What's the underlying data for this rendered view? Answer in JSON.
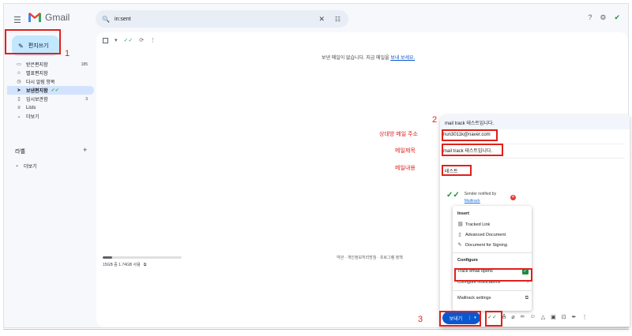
{
  "header": {
    "app_name": "Gmail",
    "search_value": "in:sent"
  },
  "compose_button": {
    "label": "편지쓰기"
  },
  "sidebar": {
    "items": [
      {
        "label": "받은편지함",
        "count": "185"
      },
      {
        "label": "별표편지함",
        "count": ""
      },
      {
        "label": "다시 알림 항목",
        "count": ""
      },
      {
        "label": "보낸편지함",
        "count": ""
      },
      {
        "label": "임시보관함",
        "count": "3"
      },
      {
        "label": "Lists",
        "count": ""
      },
      {
        "label": "더보기",
        "count": ""
      }
    ],
    "labels_title": "라벨",
    "labels_more": "더보기"
  },
  "main": {
    "empty_message": "보낸 메일이 없습니다. 지금 메일을 ",
    "empty_link": "보내 보세요.",
    "storage": {
      "text": "15GB 중 1.74GB 사용",
      "used_fraction": 0.12
    },
    "footer": "약관 · 개인정보처리방침 · 프로그램 정책"
  },
  "compose_window": {
    "title": "mail track 테스트입니다.",
    "to": "hun3011k@naver.com",
    "subject": "mail track 테스트입니다.",
    "body": "테스트",
    "mailtrack_note_line1": "Sender notified by",
    "mailtrack_note_link": "Mailtrack",
    "send_label": "보내기"
  },
  "mailtrack_menu": {
    "insert_title": "Insert",
    "insert_items": [
      "Tracked Link",
      "Advanced Document",
      "Document for Signing"
    ],
    "configure_title": "Configure",
    "track_opens": "Track email opens",
    "configure_notifications": "Configure notifications",
    "settings": "Mailtrack settings"
  },
  "annotations": {
    "n1": "1",
    "n2": "2",
    "n3": "3",
    "to_label": "상대방 메일 주소",
    "subject_label": "메일제목",
    "body_label": "메일내용"
  },
  "colors": {
    "annotation": "#e0201b",
    "compose_bg": "#c2e7ff",
    "send": "#0b57d0",
    "mailtrack_green": "#1e8e3e"
  }
}
